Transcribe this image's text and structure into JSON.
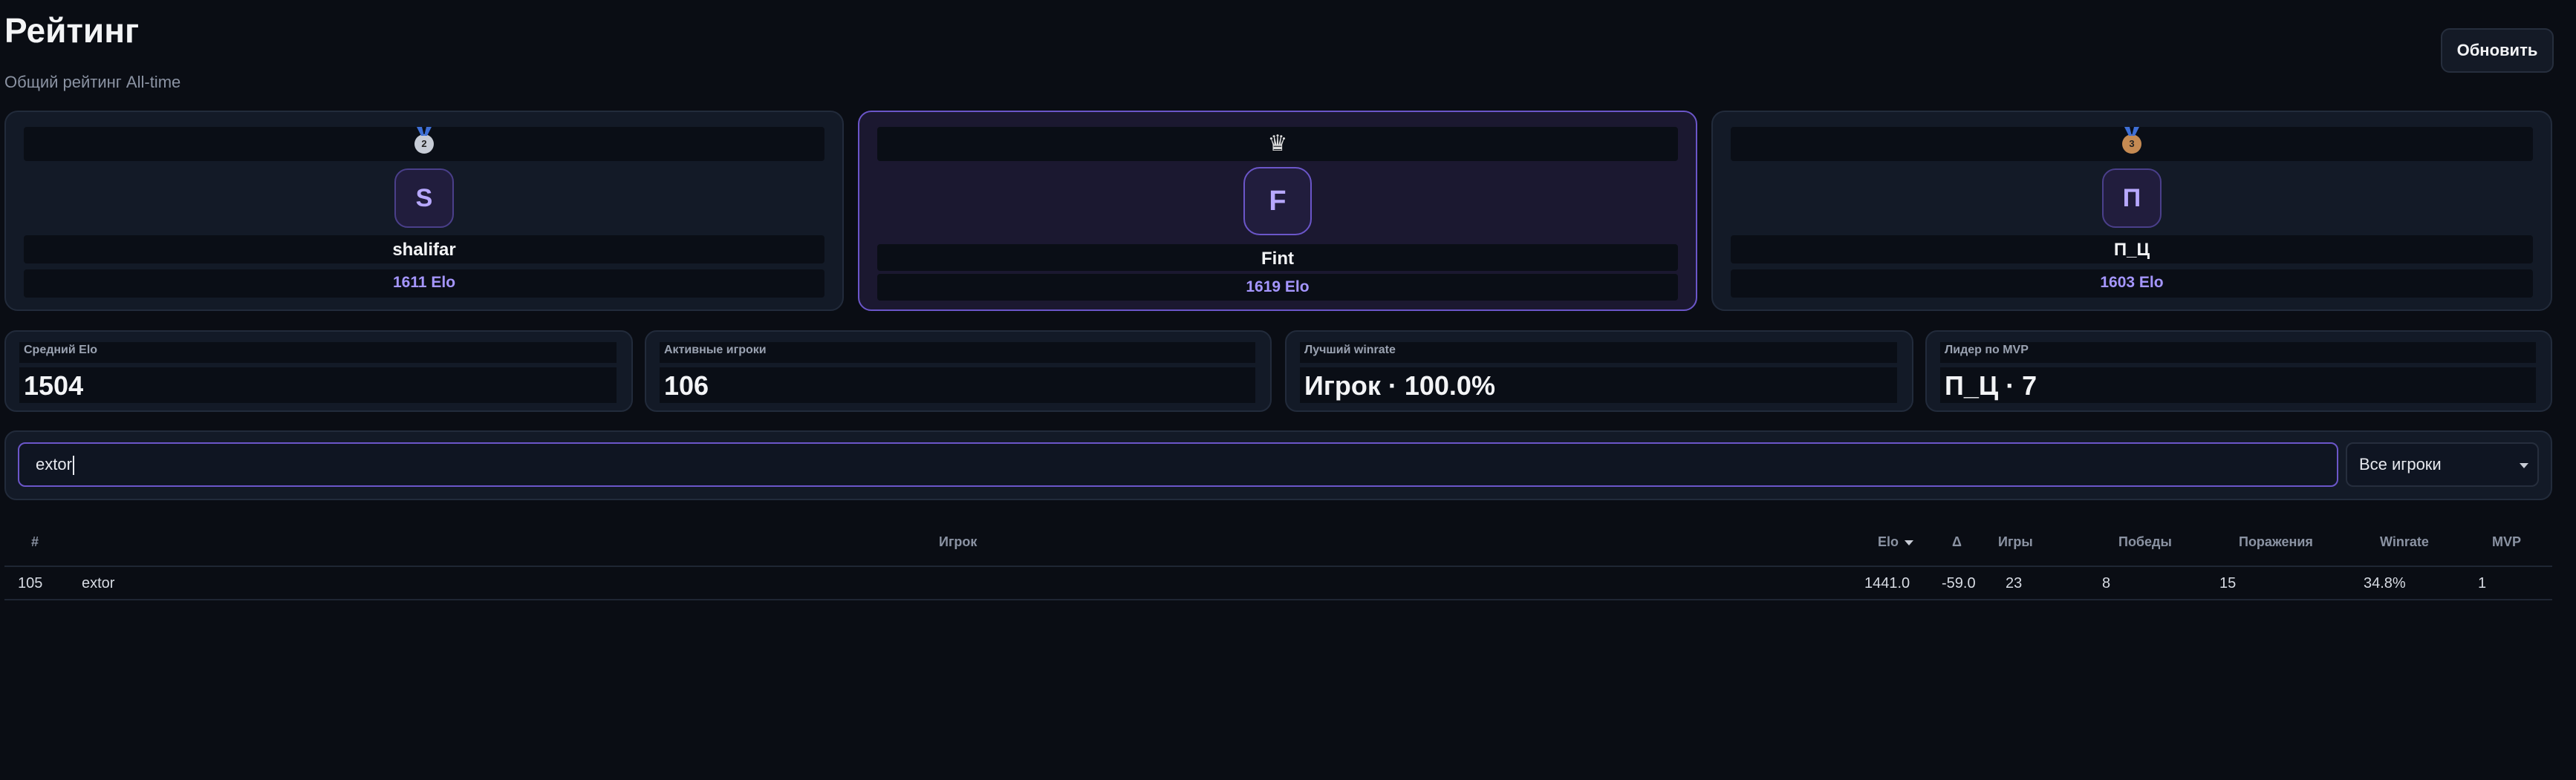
{
  "header": {
    "title": "Рейтинг",
    "subtitle": "Общий рейтинг All-time",
    "refresh_label": "Обновить"
  },
  "podium": [
    {
      "place": 2,
      "medal_icon": "silver-medal-icon",
      "medal_number": "2",
      "initial": "S",
      "name": "shalifar",
      "elo": "1611 Elo"
    },
    {
      "place": 1,
      "medal_icon": "crown-icon",
      "initial": "F",
      "name": "Fint",
      "elo": "1619 Elo"
    },
    {
      "place": 3,
      "medal_icon": "bronze-medal-icon",
      "medal_number": "3",
      "initial": "П",
      "name": "П_Ц",
      "elo": "1603 Elo"
    }
  ],
  "stats": [
    {
      "label": "Средний Elo",
      "value": "1504"
    },
    {
      "label": "Активные игроки",
      "value": "106"
    },
    {
      "label": "Лучший winrate",
      "value": "Игрок · 100.0%"
    },
    {
      "label": "Лидер по MVP",
      "value": "П_Ц · 7"
    }
  ],
  "filters": {
    "search_value": "extor",
    "select_value": "Все игроки"
  },
  "table": {
    "columns": {
      "rank": "#",
      "player": "Игрок",
      "elo": "Elo",
      "delta": "Δ",
      "games": "Игры",
      "wins": "Победы",
      "losses": "Поражения",
      "winrate": "Winrate",
      "mvp": "MVP"
    },
    "rows": [
      {
        "rank": "105",
        "player": "extor",
        "elo": "1441.0",
        "delta": "-59.0",
        "games": "23",
        "wins": "8",
        "losses": "15",
        "winrate": "34.8%",
        "mvp": "1"
      }
    ]
  },
  "colors": {
    "background": "#0a0d14",
    "accent": "#6b56c9",
    "elo_text": "#a596ff",
    "card": "#131a27"
  }
}
